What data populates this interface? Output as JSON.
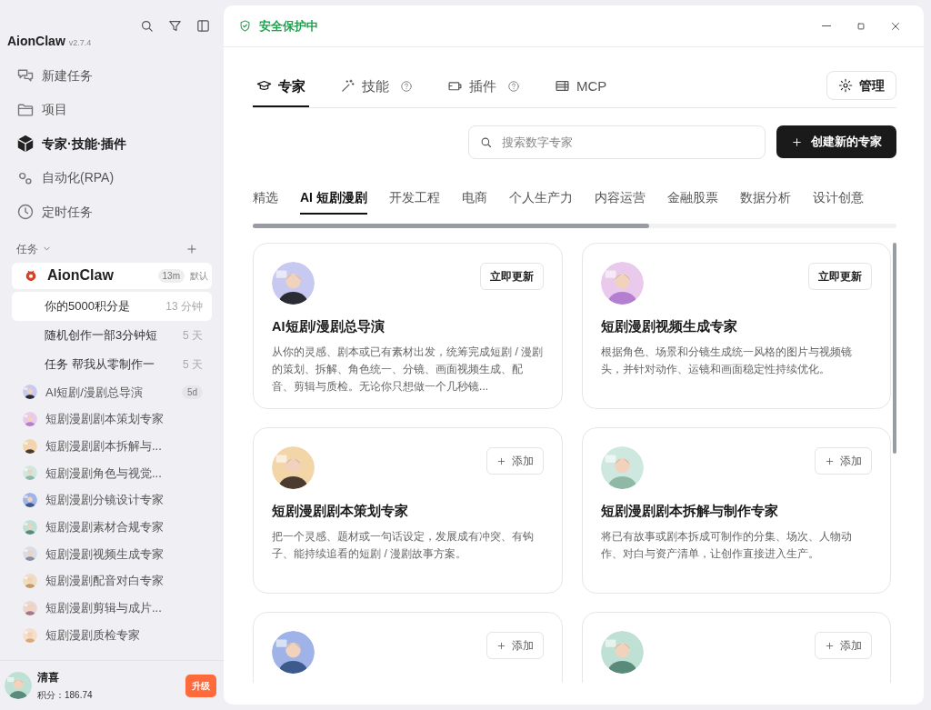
{
  "sidebar": {
    "brand": "AionClaw",
    "version": "v2.7.4",
    "nav": [
      {
        "label": "新建任务",
        "selected": false
      },
      {
        "label": "项目",
        "selected": false
      },
      {
        "label": "专家·技能·插件",
        "selected": true
      },
      {
        "label": "自动化(RPA)",
        "selected": false
      },
      {
        "label": "定时任务",
        "selected": false
      }
    ],
    "tasks_header": "任务",
    "agent": {
      "name": "AionClaw",
      "badge": "13m",
      "tag": "默认"
    },
    "tasks": [
      {
        "title": "你的5000积分是",
        "time": "13 分钟",
        "selected": true
      },
      {
        "title": "随机创作一部3分钟短",
        "time": "5 天",
        "selected": false
      },
      {
        "title": "任务 帮我从零制作一",
        "time": "5 天",
        "selected": false
      }
    ],
    "experts": [
      {
        "name": "AI短剧/漫剧总导演",
        "badge": "5d"
      },
      {
        "name": "短剧漫剧剧本策划专家"
      },
      {
        "name": "短剧漫剧剧本拆解与..."
      },
      {
        "name": "短剧漫剧角色与视觉..."
      },
      {
        "name": "短剧漫剧分镜设计专家"
      },
      {
        "name": "短剧漫剧素材合规专家"
      },
      {
        "name": "短剧漫剧视频生成专家"
      },
      {
        "name": "短剧漫剧配音对白专家"
      },
      {
        "name": "短剧漫剧剪辑与成片..."
      },
      {
        "name": "短剧漫剧质检专家"
      }
    ],
    "user": {
      "name": "清喜",
      "points": "积分：186.74",
      "upgrade": "升级"
    }
  },
  "main": {
    "security": "安全保护中",
    "tabs": [
      {
        "label": "专家",
        "help": false,
        "selected": true
      },
      {
        "label": "技能",
        "help": true,
        "selected": false
      },
      {
        "label": "插件",
        "help": true,
        "selected": false
      },
      {
        "label": "MCP",
        "help": false,
        "selected": false
      }
    ],
    "manage": "管理",
    "search": {
      "placeholder": "搜索数字专家"
    },
    "create": "创建新的专家",
    "categories": [
      {
        "label": "精选",
        "selected": false
      },
      {
        "label": "AI 短剧漫剧",
        "selected": true
      },
      {
        "label": "开发工程",
        "selected": false
      },
      {
        "label": "电商",
        "selected": false
      },
      {
        "label": "个人生产力",
        "selected": false
      },
      {
        "label": "内容运营",
        "selected": false
      },
      {
        "label": "金融股票",
        "selected": false
      },
      {
        "label": "数据分析",
        "selected": false
      },
      {
        "label": "设计创意",
        "selected": false
      }
    ],
    "cards": [
      {
        "kind": "update",
        "action": "立即更新",
        "title": "AI短剧/漫剧总导演",
        "description": "从你的灵感、剧本或已有素材出发，统筹完成短剧 / 漫剧的策划、拆解、角色统一、分镜、画面视频生成、配音、剪辑与质检。无论你只想做一个几秒镜..."
      },
      {
        "kind": "update",
        "action": "立即更新",
        "title": "短剧漫剧视频生成专家",
        "description": "根据角色、场景和分镜生成统一风格的图片与视频镜头，并针对动作、运镜和画面稳定性持续优化。"
      },
      {
        "kind": "add",
        "action": "添加",
        "title": "短剧漫剧剧本策划专家",
        "description": "把一个灵感、题材或一句话设定，发展成有冲突、有钩子、能持续追看的短剧 / 漫剧故事方案。"
      },
      {
        "kind": "add",
        "action": "添加",
        "title": "短剧漫剧剧本拆解与制作专家",
        "description": "将已有故事或剧本拆成可制作的分集、场次、人物动作、对白与资产清单，让创作直接进入生产。"
      },
      {
        "kind": "add",
        "action": "添加"
      },
      {
        "kind": "add",
        "action": "添加"
      }
    ]
  }
}
